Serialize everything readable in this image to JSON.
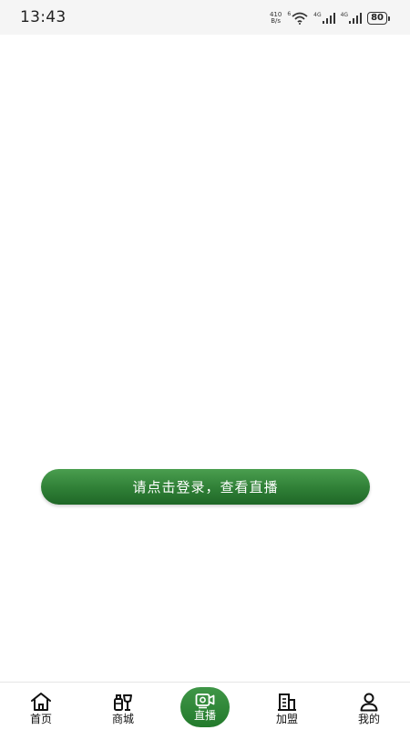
{
  "status_bar": {
    "time": "13:43",
    "net_speed_value": "410",
    "net_speed_unit": "B/s",
    "wifi_tag": "6",
    "signal1_tag": "4G",
    "signal2_tag": "4G",
    "battery": "80"
  },
  "main": {
    "login_prompt": "请点击登录，查看直播"
  },
  "tabbar": {
    "active_tab": "直播",
    "accent_color": "#2f8a37",
    "tabs": [
      {
        "label": "首页",
        "icon": "home-icon"
      },
      {
        "label": "商城",
        "icon": "shop-icon"
      },
      {
        "label": "直播",
        "icon": "live-camera-icon"
      },
      {
        "label": "加盟",
        "icon": "building-icon"
      },
      {
        "label": "我的",
        "icon": "user-icon"
      }
    ]
  }
}
